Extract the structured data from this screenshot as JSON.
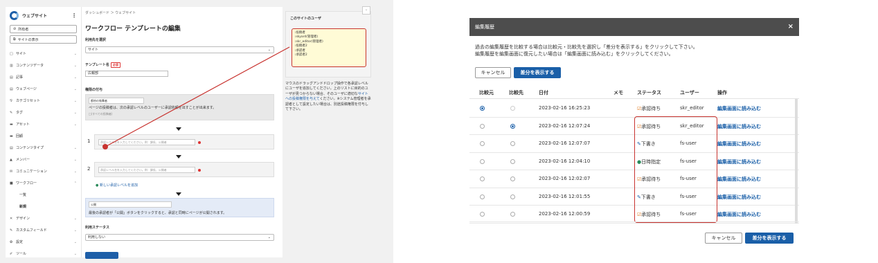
{
  "left": {
    "sidebar": {
      "app_name": "ウェブサイト",
      "buttons": [
        "所有者",
        "サイトの表示"
      ],
      "items": [
        {
          "icon": "□",
          "label": "サイト"
        },
        {
          "icon": "▥",
          "label": "コンテンツデータ"
        },
        {
          "icon": "▤",
          "label": "記事"
        },
        {
          "icon": "▤",
          "label": "ウェブページ"
        },
        {
          "icon": "⅋",
          "label": "カテゴリセット"
        },
        {
          "icon": "✎",
          "label": "タグ"
        },
        {
          "icon": "▬",
          "label": "アセット"
        },
        {
          "icon": "▬",
          "label": "回顧"
        },
        {
          "icon": "▤",
          "label": "コンテンツタイプ"
        },
        {
          "icon": "▲",
          "label": "メンバー"
        },
        {
          "icon": "✉",
          "label": "コミュニケーション"
        },
        {
          "icon": "■",
          "label": "ワークフロー"
        }
      ],
      "sub_items": [
        "一覧",
        "新規"
      ],
      "items_after": [
        {
          "icon": "✕",
          "label": "デザイン"
        },
        {
          "icon": "✎",
          "label": "カスタムフィールド"
        },
        {
          "icon": "✿",
          "label": "設定"
        },
        {
          "icon": "✐",
          "label": "ツール"
        }
      ]
    },
    "main": {
      "breadcrumb": "ダッシュボード ＞ ウェブサイト",
      "title": "ワークフロー テンプレートの編集",
      "target_label": "利用先を選択",
      "target_value": "サイト",
      "template_label": "テンプレート名",
      "required": "必須",
      "template_value": "広報部",
      "auth_label": "権限の付与",
      "author_box_value": "都府の執筆者",
      "author_desc": "ページの投稿者は、次の承認レベルのユーザーに承認依頼を出すことが出来ます。",
      "author_hint": "□(すべての投稿者)",
      "step_placeholder": "承認レベル名を入力してください。例：課長、公開者",
      "add_level": "新しい承認レベルを追加",
      "publish_value": "公開",
      "publish_desc": "最後の承認者が「公開」ボタンをクリックすると、承認と同時にページが公開されます。",
      "status_label": "利用ステータス",
      "status_value": "利用しない"
    },
    "panel": {
      "title": "このサイトのユーザ",
      "users": [
        "投稿者",
        "skyard(管理者)",
        "skr_editor(管理者)",
        "投稿者2",
        "承認者",
        "承認者2"
      ],
      "desc_1": "マウスのドラッグアンドドロップ操作で各承認レベルにユーザを追加してください。上のリストに目的のユーザが見つからない場合、そのユーザに適切な",
      "desc_link": "サイトへの投稿権限を与えて",
      "desc_2": "ください。※システム管理者を承認者として設定したい場合は、別途投稿権限を付与して下さい。"
    }
  },
  "modal": {
    "title": "編集履歴",
    "desc_line1": "過去の編集履歴を比較する場合は比較元・比較先を選択し「差分を表示する」をクリックして下さい。",
    "desc_line2": "編集履歴を編集画面に復元したい場合は「編集画面に読み込む」をクリックしてください。",
    "cancel": "キャンセル",
    "show_diff": "差分を表示する",
    "columns": [
      "比較元",
      "比較先",
      "日付",
      "メモ",
      "ステータス",
      "ユーザー",
      "操作"
    ],
    "rows": [
      {
        "date": "2023-02-16 16:25:23",
        "status": "承認待ち",
        "user": "skr_editor",
        "action": "編集画面に読み込む"
      },
      {
        "date": "2023-02-16 12:07:24",
        "status": "承認待ち",
        "user": "skr_editor",
        "action": "編集画面に読み込む"
      },
      {
        "date": "2023-02-16 12:07:07",
        "status": "下書き",
        "user": "fs-user",
        "action": "編集画面に読み込む"
      },
      {
        "date": "2023-02-16 12:04:10",
        "status": "日時指定",
        "user": "fs-user",
        "action": "編集画面に読み込む"
      },
      {
        "date": "2023-02-16 12:02:07",
        "status": "承認待ち",
        "user": "fs-user",
        "action": "編集画面に読み込む"
      },
      {
        "date": "2023-02-16 12:01:55",
        "status": "下書き",
        "user": "fs-user",
        "action": "編集画面に読み込む"
      },
      {
        "date": "2023-02-16 12:00:59",
        "status": "承認待ち",
        "user": "fs-user",
        "action": "編集画面に読み込む"
      }
    ],
    "footer_cancel": "キャンセル",
    "footer_diff": "差分を表示する"
  }
}
